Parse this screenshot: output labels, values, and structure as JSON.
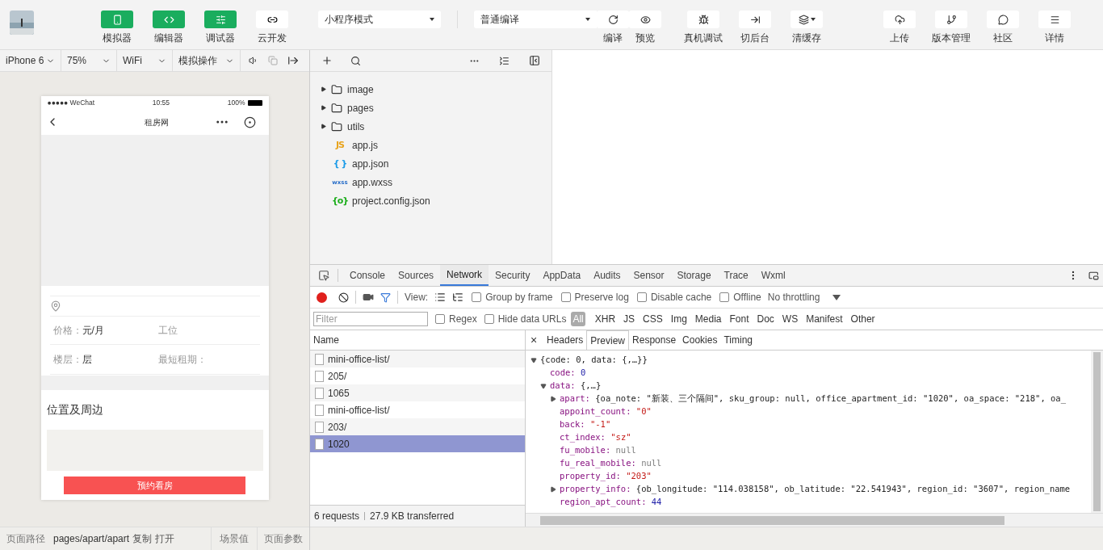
{
  "toolbar": {
    "views": [
      {
        "label": "模拟器",
        "on": true,
        "kind": "phone"
      },
      {
        "label": "编辑器",
        "on": true,
        "kind": "code"
      },
      {
        "label": "调试器",
        "on": true,
        "kind": "sliders"
      },
      {
        "label": "云开发",
        "on": false,
        "kind": "cloud"
      }
    ],
    "mode_select": "小程序模式",
    "compile_select": "普通编译",
    "actions": [
      {
        "label": "编译",
        "kind": "refresh"
      },
      {
        "label": "预览",
        "kind": "eye"
      },
      {
        "label": "真机调试",
        "kind": "bug"
      },
      {
        "label": "切后台",
        "kind": "switch"
      },
      {
        "label": "清缓存",
        "kind": "layers"
      }
    ],
    "right_actions": [
      {
        "label": "上传",
        "kind": "upload"
      },
      {
        "label": "版本管理",
        "kind": "branch"
      },
      {
        "label": "社区",
        "kind": "chat"
      },
      {
        "label": "详情",
        "kind": "menu"
      }
    ]
  },
  "simulator_bar": [
    "iPhone 6",
    "75%",
    "WiFi",
    "模拟操作"
  ],
  "phone": {
    "carrier": "●●●●● WeChat",
    "time": "10:55",
    "battery": "100%",
    "title": "租房网",
    "rows": [
      [
        {
          "label": "价格：",
          "value": "元/月"
        },
        {
          "label": "工位"
        }
      ],
      [
        {
          "label": "楼层：",
          "value": "层"
        },
        {
          "label": "最短租期："
        }
      ]
    ],
    "section_title": "位置及周边",
    "book_button": "预约看房"
  },
  "footer": {
    "path_label": "页面路径",
    "path": "pages/apart/apart",
    "copy": "复制",
    "open": "打开",
    "scene": "场景值",
    "params": "页面参数"
  },
  "files": [
    {
      "name": "image",
      "kind": "folder",
      "expanded": false
    },
    {
      "name": "pages",
      "kind": "folder",
      "expanded": false
    },
    {
      "name": "utils",
      "kind": "folder",
      "expanded": false
    },
    {
      "name": "app.js",
      "kind": "file",
      "badge": "JS",
      "color": "#e8a31c"
    },
    {
      "name": "app.json",
      "kind": "file",
      "badge": "{ }",
      "color": "#1a9be8"
    },
    {
      "name": "app.wxss",
      "kind": "file",
      "badge": "wxss",
      "color": "#2a6fc9"
    },
    {
      "name": "project.config.json",
      "kind": "file",
      "badge": "{o}",
      "color": "#1aad19"
    }
  ],
  "devtools": {
    "tabs": [
      {
        "label": "Console",
        "selected": false
      },
      {
        "label": "Sources",
        "selected": false
      },
      {
        "label": "Network",
        "selected": true
      },
      {
        "label": "Security",
        "selected": false
      },
      {
        "label": "AppData",
        "selected": false
      },
      {
        "label": "Audits",
        "selected": false
      },
      {
        "label": "Sensor",
        "selected": false
      },
      {
        "label": "Storage",
        "selected": false
      },
      {
        "label": "Trace",
        "selected": false
      },
      {
        "label": "Wxml",
        "selected": false
      }
    ],
    "view_label": "View:",
    "options": [
      {
        "label": "Group by frame",
        "checked": false
      },
      {
        "label": "Preserve log",
        "checked": false
      },
      {
        "label": "Disable cache",
        "checked": false
      },
      {
        "label": "Offline",
        "checked": false
      }
    ],
    "throttling": "No throttling",
    "filter_placeholder": "Filter",
    "filter_options": [
      {
        "label": "Regex",
        "checked": false
      },
      {
        "label": "Hide data URLs",
        "checked": false
      }
    ],
    "types": [
      {
        "label": "All",
        "selected": true
      },
      {
        "label": "XHR",
        "selected": false
      },
      {
        "label": "JS",
        "selected": false
      },
      {
        "label": "CSS",
        "selected": false
      },
      {
        "label": "Img",
        "selected": false
      },
      {
        "label": "Media",
        "selected": false
      },
      {
        "label": "Font",
        "selected": false
      },
      {
        "label": "Doc",
        "selected": false
      },
      {
        "label": "WS",
        "selected": false
      },
      {
        "label": "Manifest",
        "selected": false
      },
      {
        "label": "Other",
        "selected": false
      }
    ],
    "name_header": "Name",
    "requests": [
      {
        "name": "mini-office-list/",
        "selected": false
      },
      {
        "name": "205/",
        "selected": false
      },
      {
        "name": "1065",
        "selected": false
      },
      {
        "name": "mini-office-list/",
        "selected": false
      },
      {
        "name": "203/",
        "selected": false
      },
      {
        "name": "1020",
        "selected": true
      }
    ],
    "summary_requests": "6 requests",
    "summary_transferred": "27.9 KB transferred",
    "close": "×",
    "detail_tabs": [
      {
        "label": "Headers",
        "selected": false
      },
      {
        "label": "Preview",
        "selected": true
      },
      {
        "label": "Response",
        "selected": false
      },
      {
        "label": "Cookies",
        "selected": false
      },
      {
        "label": "Timing",
        "selected": false
      }
    ],
    "preview": {
      "value": "{code: 0, data: {,…}}",
      "kind": "object",
      "expanded": true,
      "children": [
        {
          "key": "code:",
          "value": "0",
          "kind": "number"
        },
        {
          "key": "data:",
          "value": "{,…}",
          "kind": "object",
          "expanded": true,
          "children": [
            {
              "key": "apart:",
              "value": "{oa_note: \"新装、三个隔间\", sku_group: null, office_apartment_id: \"1020\", oa_space: \"218\", oa_",
              "kind": "object",
              "expanded": false
            },
            {
              "key": "appoint_count:",
              "value": "\"0\"",
              "kind": "string"
            },
            {
              "key": "back:",
              "value": "\"-1\"",
              "kind": "string"
            },
            {
              "key": "ct_index:",
              "value": "\"sz\"",
              "kind": "string"
            },
            {
              "key": "fu_mobile:",
              "value": "null",
              "kind": "null"
            },
            {
              "key": "fu_real_mobile:",
              "value": "null",
              "kind": "null"
            },
            {
              "key": "property_id:",
              "value": "\"203\"",
              "kind": "string"
            },
            {
              "key": "property_info:",
              "value": "{ob_longitude: \"114.038158\", ob_latitude: \"22.541943\", region_id: \"3607\", region_name",
              "kind": "object",
              "expanded": false
            },
            {
              "key": "region_apt_count:",
              "value": "44",
              "kind": "number"
            }
          ]
        }
      ]
    }
  }
}
